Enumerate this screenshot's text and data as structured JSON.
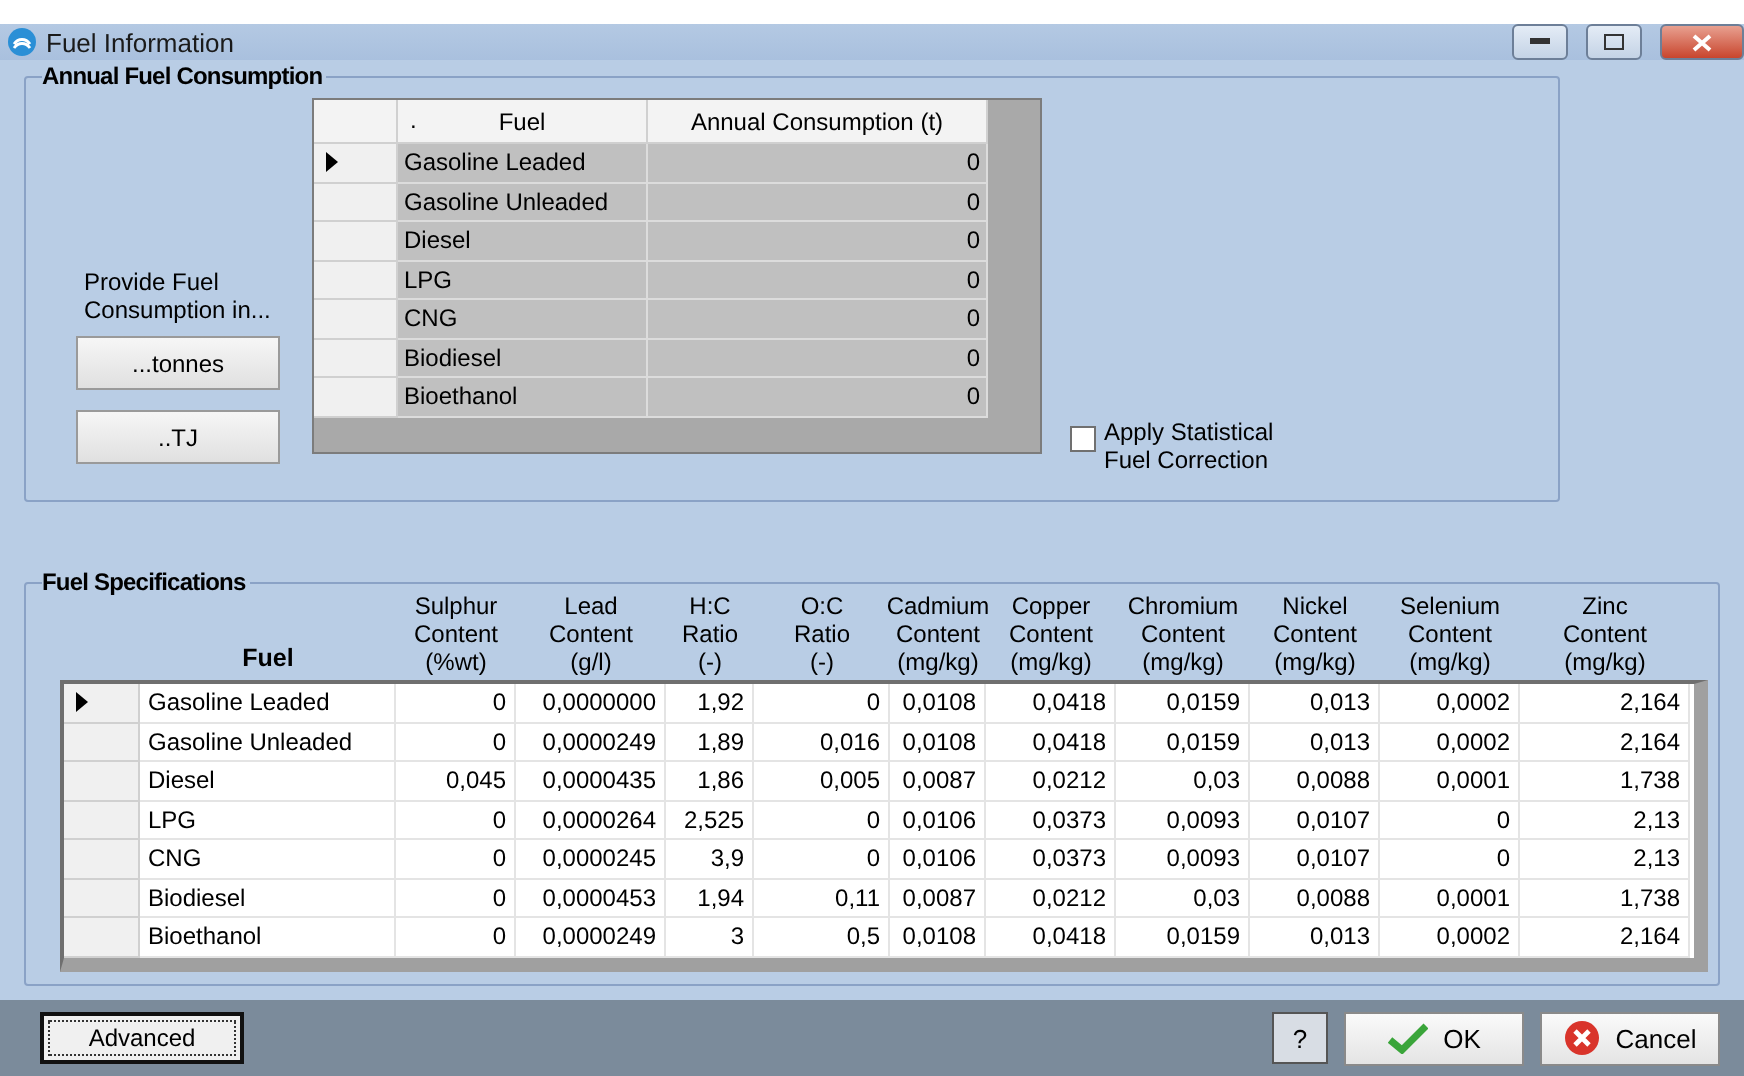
{
  "window": {
    "title": "Fuel Information"
  },
  "consumption": {
    "title": "Annual Fuel Consumption",
    "columns": [
      ".",
      "Fuel",
      "Annual Consumption (t)"
    ],
    "rows": [
      {
        "fuel": "Gasoline Leaded",
        "value": "0",
        "selected": true
      },
      {
        "fuel": "Gasoline Unleaded",
        "value": "0",
        "selected": false
      },
      {
        "fuel": "Diesel",
        "value": "0",
        "selected": false
      },
      {
        "fuel": "LPG",
        "value": "0",
        "selected": false
      },
      {
        "fuel": "CNG",
        "value": "0",
        "selected": false
      },
      {
        "fuel": "Biodiesel",
        "value": "0",
        "selected": false
      },
      {
        "fuel": "Bioethanol",
        "value": "0",
        "selected": false
      }
    ]
  },
  "provide_label": "Provide Fuel\nConsumption in...",
  "unit_buttons": [
    "...tonnes",
    "..TJ"
  ],
  "statistical_correction": {
    "label": "Apply Statistical\nFuel Correction",
    "checked": false
  },
  "specifications": {
    "title": "Fuel Specifications",
    "columns": [
      "Fuel",
      "Sulphur\nContent\n(%wt)",
      "Lead\nContent\n(g/l)",
      "H:C\nRatio\n(-)",
      "O:C\nRatio\n(-)",
      "Cadmium\nContent\n(mg/kg)",
      "Copper\nContent\n(mg/kg)",
      "Chromium\nContent\n(mg/kg)",
      "Nickel\nContent\n(mg/kg)",
      "Selenium\nContent\n(mg/kg)",
      "Zinc\nContent\n(mg/kg)"
    ],
    "rows": [
      {
        "selected": true,
        "cells": [
          "Gasoline Leaded",
          "0",
          "0,0000000",
          "1,92",
          "0",
          "0,0108",
          "0,0418",
          "0,0159",
          "0,013",
          "0,0002",
          "2,164"
        ]
      },
      {
        "selected": false,
        "cells": [
          "Gasoline Unleaded",
          "0",
          "0,0000249",
          "1,89",
          "0,016",
          "0,0108",
          "0,0418",
          "0,0159",
          "0,013",
          "0,0002",
          "2,164"
        ]
      },
      {
        "selected": false,
        "cells": [
          "Diesel",
          "0,045",
          "0,0000435",
          "1,86",
          "0,005",
          "0,0087",
          "0,0212",
          "0,03",
          "0,0088",
          "0,0001",
          "1,738"
        ]
      },
      {
        "selected": false,
        "cells": [
          "LPG",
          "0",
          "0,0000264",
          "2,525",
          "0",
          "0,0106",
          "0,0373",
          "0,0093",
          "0,0107",
          "0",
          "2,13"
        ]
      },
      {
        "selected": false,
        "cells": [
          "CNG",
          "0",
          "0,0000245",
          "3,9",
          "0",
          "0,0106",
          "0,0373",
          "0,0093",
          "0,0107",
          "0",
          "2,13"
        ]
      },
      {
        "selected": false,
        "cells": [
          "Biodiesel",
          "0",
          "0,0000453",
          "1,94",
          "0,11",
          "0,0087",
          "0,0212",
          "0,03",
          "0,0088",
          "0,0001",
          "1,738"
        ]
      },
      {
        "selected": false,
        "cells": [
          "Bioethanol",
          "0",
          "0,0000249",
          "3",
          "0,5",
          "0,0108",
          "0,0418",
          "0,0159",
          "0,013",
          "0,0002",
          "2,164"
        ]
      }
    ]
  },
  "footer": {
    "advanced": "Advanced",
    "help": "?",
    "ok": "OK",
    "cancel": "Cancel"
  }
}
